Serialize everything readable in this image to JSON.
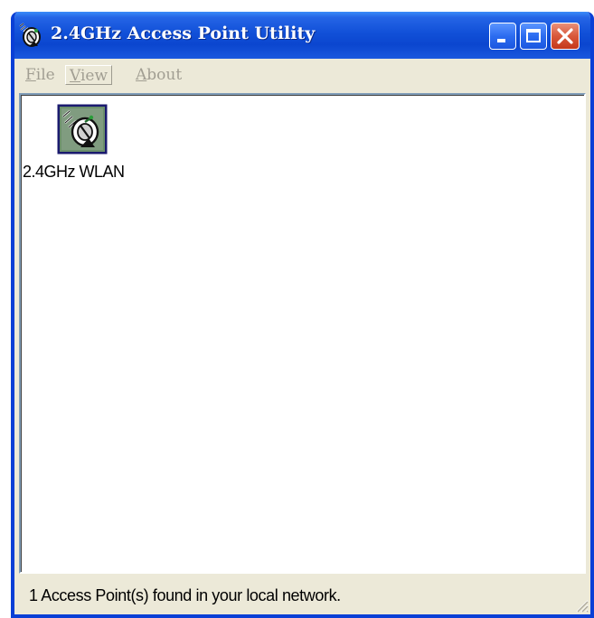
{
  "window": {
    "title": "2.4GHz Access Point Utility"
  },
  "menu": {
    "file": {
      "accel": "F",
      "rest": "ile"
    },
    "view": {
      "accel": "V",
      "rest": "iew"
    },
    "about": {
      "accel": "A",
      "rest": "bout"
    }
  },
  "devices": [
    {
      "label": "2.4GHz WLAN",
      "icon": "wireless-ap-icon"
    }
  ],
  "status": {
    "text": "1 Access Point(s) found in your local network."
  },
  "colors": {
    "titlebar_blue": "#0b46cf",
    "close_red": "#c4391c",
    "face": "#ece9d8",
    "disabled_text": "#a19e92",
    "icon_bg": "#6b8f6b"
  }
}
